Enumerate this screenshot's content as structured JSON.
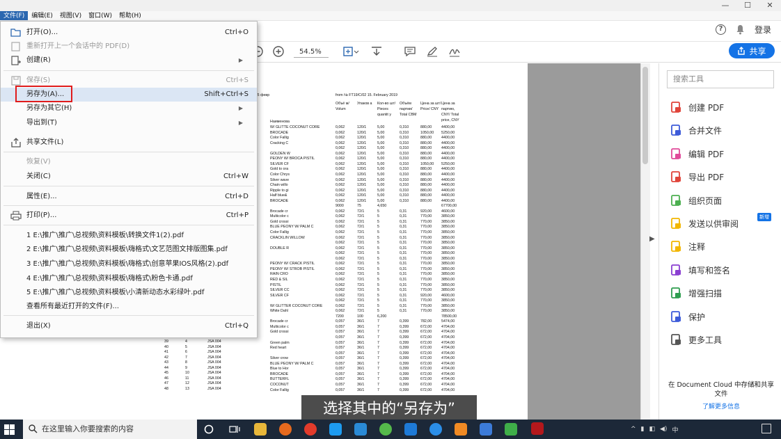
{
  "menubar": {
    "items": [
      "文件(F)",
      "编辑(E)",
      "视图(V)",
      "窗口(W)",
      "帮助(H)"
    ]
  },
  "header": {
    "login": "登录"
  },
  "toolbar": {
    "zoom": "54.5%",
    "share_label": "共享"
  },
  "file_menu": {
    "items": [
      {
        "label": "打开(O)...",
        "shortcut": "Ctrl+O",
        "icon": "folder-open-icon"
      },
      {
        "label": "重新打开上一个会话中的 PDF(D)",
        "shortcut": "",
        "disabled": true,
        "icon": "reopen-icon"
      },
      {
        "label": "创建(R)",
        "shortcut": "",
        "arrow": true,
        "icon": "create-pdf-icon"
      },
      {
        "label": "保存(S)",
        "shortcut": "Ctrl+S",
        "disabled": true,
        "icon": "save-icon"
      },
      {
        "label": "另存为(A)...",
        "shortcut": "Shift+Ctrl+S",
        "highlight": true
      },
      {
        "label": "另存为其它(H)",
        "shortcut": "",
        "arrow": true
      },
      {
        "label": "导出到(T)",
        "shortcut": "",
        "arrow": true
      },
      {
        "label": "共享文件(L)",
        "shortcut": "",
        "icon": "share-file-icon"
      },
      {
        "label": "恢复(V)",
        "shortcut": "",
        "disabled": true
      },
      {
        "label": "关闭(C)",
        "shortcut": "Ctrl+W"
      },
      {
        "label": "属性(E)...",
        "shortcut": "Ctrl+D"
      },
      {
        "label": "打印(P)...",
        "shortcut": "Ctrl+P",
        "icon": "printer-icon"
      },
      {
        "label": "1 E:\\推广\\推广\\总视频\\资料模板\\转换文件1(2).pdf",
        "shortcut": ""
      },
      {
        "label": "2 E:\\推广\\推广\\总视频\\资料模板\\嗨格式\\文艺范图文排版图集.pdf",
        "shortcut": ""
      },
      {
        "label": "3 E:\\推广\\推广\\总视频\\资料模板\\嗨格式\\创意苹果IOS风格(2).pdf",
        "shortcut": ""
      },
      {
        "label": "4 E:\\推广\\推广\\总视频\\资料模板\\嗨格式\\粉色卡通.pdf",
        "shortcut": ""
      },
      {
        "label": "5 E:\\推广\\推广\\总视频\\资料模板\\小清新动态水彩绿叶.pdf",
        "shortcut": ""
      },
      {
        "label": "查看所有最近打开的文件(F)...",
        "shortcut": ""
      },
      {
        "label": "退出(X)",
        "shortcut": "Ctrl+Q"
      }
    ]
  },
  "right_panel": {
    "search_placeholder": "搜索工具",
    "tools": [
      {
        "label": "创建 PDF",
        "icon": "create-pdf-tool-icon",
        "color": "#e0443a"
      },
      {
        "label": "合并文件",
        "icon": "combine-files-icon",
        "color": "#3d5bd9"
      },
      {
        "label": "编辑 PDF",
        "icon": "edit-pdf-icon",
        "color": "#e04a9a"
      },
      {
        "label": "导出 PDF",
        "icon": "export-pdf-icon",
        "color": "#e0443a"
      },
      {
        "label": "组织页面",
        "icon": "organize-pages-icon",
        "color": "#4caf50"
      },
      {
        "label": "发送以供审阅",
        "icon": "send-review-icon",
        "color": "#f2b600"
      },
      {
        "label": "注释",
        "icon": "comment-icon",
        "color": "#f2b600"
      },
      {
        "label": "填写和签名",
        "icon": "fill-sign-icon",
        "color": "#8a3fd1"
      },
      {
        "label": "增强扫描",
        "icon": "enhance-scan-icon",
        "color": "#2e9d4f"
      },
      {
        "label": "保护",
        "icon": "protect-icon",
        "color": "#3d5bd9"
      },
      {
        "label": "更多工具",
        "icon": "more-tools-icon",
        "color": "#555555"
      }
    ],
    "new_badge": "新增",
    "cloud_text": "在 Document Cloud 中存储和共享文件",
    "cloud_link": "了解更多信息"
  },
  "document": {
    "header_left": "от 15 февр",
    "header_mid": "from № FT19/C/02 15. February 2019",
    "col_headers": [
      "Объё м/ Volum",
      "Упаков а",
      "Кол-во шт/ Pieces quantit y",
      "Объём партии/ Total CBM",
      "Цена за шт/ Price/ CNY",
      "Цена за партию, CNY/ Total price, CNY"
    ],
    "col_name": "Наименова",
    "rows": [
      {
        "name": "W/ GLITTE COCONUT CORE",
        "v": "0,062",
        "p": "120/1",
        "q": "5,00",
        "c": "0,310",
        "pr": "880,00",
        "t": "4400,00"
      },
      {
        "name": "BROCADE",
        "v": "0,062",
        "p": "120/1",
        "q": "5,00",
        "c": "0,310",
        "pr": "1050,00",
        "t": "5250,00"
      },
      {
        "name": "Color Fallig",
        "v": "0,062",
        "p": "120/1",
        "q": "5,00",
        "c": "0,310",
        "pr": "880,00",
        "t": "4400,00"
      },
      {
        "name": "Cracking C",
        "v": "0,062",
        "p": "120/1",
        "q": "5,00",
        "c": "0,310",
        "pr": "880,00",
        "t": "4400,00"
      },
      {
        "name": "",
        "v": "0,062",
        "p": "120/1",
        "q": "5,00",
        "c": "0,310",
        "pr": "880,00",
        "t": "4400,00"
      },
      {
        "name": "GOLDEN W",
        "v": "0,062",
        "p": "120/1",
        "q": "5,00",
        "c": "0,310",
        "pr": "880,00",
        "t": "4400,00"
      },
      {
        "name": "PEONY   W/ BROCA PISTIL",
        "v": "0,062",
        "p": "120/1",
        "q": "5,00",
        "c": "0,310",
        "pr": "880,00",
        "t": "4400,00"
      },
      {
        "name": "SILVER CF",
        "v": "0,062",
        "p": "120/1",
        "q": "5,00",
        "c": "0,310",
        "pr": "1050,00",
        "t": "5250,00"
      },
      {
        "name": "Gold to ora",
        "v": "0,062",
        "p": "120/1",
        "q": "5,00",
        "c": "0,310",
        "pr": "880,00",
        "t": "4400,00"
      },
      {
        "name": "Color Chrys",
        "v": "0,062",
        "p": "120/1",
        "q": "5,00",
        "c": "0,310",
        "pr": "880,00",
        "t": "4400,00"
      },
      {
        "name": "Silver wave",
        "v": "0,062",
        "p": "120/1",
        "q": "5,00",
        "c": "0,310",
        "pr": "880,00",
        "t": "4400,00"
      },
      {
        "name": "Chain willo",
        "v": "0,062",
        "p": "120/1",
        "q": "5,00",
        "c": "0,310",
        "pr": "880,00",
        "t": "4400,00"
      },
      {
        "name": "Ripple to gi",
        "v": "0,062",
        "p": "120/1",
        "q": "5,00",
        "c": "0,310",
        "pr": "880,00",
        "t": "4400,00"
      },
      {
        "name": "Half blue&",
        "v": "0,062",
        "p": "120/1",
        "q": "5,00",
        "c": "0,310",
        "pr": "880,00",
        "t": "4400,00"
      },
      {
        "name": "BROCADE",
        "v": "0,062",
        "p": "120/1",
        "q": "5,00",
        "c": "0,310",
        "pr": "880,00",
        "t": "4400,00"
      },
      {
        "name": "",
        "v": "9000",
        "p": "75",
        "q": "4,650",
        "c": "",
        "pr": "",
        "t": "67700,00"
      },
      {
        "name": "Brocade cr",
        "v": "0,062",
        "p": "72/1",
        "q": "5",
        "c": "0,31",
        "pr": "920,00",
        "t": "4600,00"
      },
      {
        "name": "Multicolor c",
        "v": "0,062",
        "p": "72/1",
        "q": "5",
        "c": "0,31",
        "pr": "770,00",
        "t": "3850,00"
      },
      {
        "name": "Gold crossi",
        "v": "0,062",
        "p": "72/1",
        "q": "5",
        "c": "0,31",
        "pr": "770,00",
        "t": "3850,00"
      },
      {
        "name": "BLUE   PEONY   W/ PALM C",
        "v": "0,062",
        "p": "72/1",
        "q": "5",
        "c": "0,31",
        "pr": "770,00",
        "t": "3850,00"
      },
      {
        "name": "Color Fallig",
        "v": "0,062",
        "p": "72/1",
        "q": "5",
        "c": "0,31",
        "pr": "770,00",
        "t": "3850,00"
      },
      {
        "name": "CRACKLIN WILLOW",
        "v": "0,062",
        "p": "72/1",
        "q": "5",
        "c": "0,31",
        "pr": "770,00",
        "t": "3850,00"
      },
      {
        "name": "",
        "v": "0,062",
        "p": "72/1",
        "q": "5",
        "c": "0,31",
        "pr": "770,00",
        "t": "3850,00"
      },
      {
        "name": "DOUBLE R",
        "v": "0,062",
        "p": "72/1",
        "q": "5",
        "c": "0,31",
        "pr": "770,00",
        "t": "3850,00"
      },
      {
        "name": "",
        "v": "0,062",
        "p": "72/1",
        "q": "5",
        "c": "0,31",
        "pr": "770,00",
        "t": "3850,00"
      },
      {
        "name": "",
        "v": "0,062",
        "p": "72/1",
        "q": "5",
        "c": "0,31",
        "pr": "770,00",
        "t": "3850,00"
      },
      {
        "name": "PEONY   W/ CRACK PISTIL",
        "v": "0,062",
        "p": "72/1",
        "q": "5",
        "c": "0,31",
        "pr": "770,00",
        "t": "3850,00"
      },
      {
        "name": "PEONY   W/ STROB PISTIL",
        "v": "0,062",
        "p": "72/1",
        "q": "5",
        "c": "0,31",
        "pr": "770,00",
        "t": "3850,00"
      },
      {
        "name": "RAIN CRO",
        "v": "0,062",
        "p": "72/1",
        "q": "5",
        "c": "0,31",
        "pr": "770,00",
        "t": "3850,00"
      },
      {
        "name": "RED & SIL",
        "v": "0,062",
        "p": "72/1",
        "q": "5",
        "c": "0,31",
        "pr": "770,00",
        "t": "3850,00"
      },
      {
        "name": "PISTIL",
        "v": "0,062",
        "p": "72/1",
        "q": "5",
        "c": "0,31",
        "pr": "770,00",
        "t": "3850,00"
      },
      {
        "name": "SILVER CC",
        "v": "0,062",
        "p": "72/1",
        "q": "5",
        "c": "0,31",
        "pr": "770,00",
        "t": "3850,00"
      },
      {
        "name": "SILVER CF",
        "v": "0,062",
        "p": "72/1",
        "q": "5",
        "c": "0,31",
        "pr": "920,00",
        "t": "4600,00"
      },
      {
        "name": "",
        "v": "0,062",
        "p": "72/1",
        "q": "5",
        "c": "0,31",
        "pr": "770,00",
        "t": "3850,00"
      },
      {
        "name": "W/   GLITTER COCONUT CORE",
        "v": "0,062",
        "p": "72/1",
        "q": "5",
        "c": "0,31",
        "pr": "770,00",
        "t": "3850,00"
      },
      {
        "name": "White Dahl",
        "v": "0,062",
        "p": "72/1",
        "q": "5",
        "c": "0,31",
        "pr": "770,00",
        "t": "3850,00"
      },
      {
        "name": "",
        "v": "7200",
        "p": "100",
        "q": "6,200",
        "c": "",
        "pr": "",
        "t": "78500,00"
      },
      {
        "name": "Brocade cr",
        "v": "0,057",
        "p": "36/1",
        "q": "7",
        "c": "0,399",
        "pr": "782,00",
        "t": "5474,00"
      },
      {
        "name": "Multicolor c",
        "v": "0,057",
        "p": "36/1",
        "q": "7",
        "c": "0,399",
        "pr": "672,00",
        "t": "4704,00"
      },
      {
        "name": "Gold crossi",
        "v": "0,057",
        "p": "36/1",
        "q": "7",
        "c": "0,399",
        "pr": "672,00",
        "t": "4704,00"
      },
      {
        "name": "",
        "v": "0,057",
        "p": "36/1",
        "q": "7",
        "c": "0,399",
        "pr": "672,00",
        "t": "4704,00"
      },
      {
        "name": "Green palm",
        "v": "0,057",
        "p": "36/1",
        "q": "7",
        "c": "0,399",
        "pr": "672,00",
        "t": "4704,00"
      },
      {
        "name": "Red heart",
        "v": "0,057",
        "p": "36/1",
        "q": "7",
        "c": "0,399",
        "pr": "672,00",
        "t": "4704,00"
      },
      {
        "name": "",
        "v": "0,057",
        "p": "36/1",
        "q": "7",
        "c": "0,399",
        "pr": "672,00",
        "t": "4704,00"
      },
      {
        "name": "Silver crow",
        "v": "0,057",
        "p": "36/1",
        "q": "7",
        "c": "0,399",
        "pr": "672,00",
        "t": "4704,00"
      },
      {
        "name": "BLUE   PEONY   W/ PALM C",
        "v": "0,057",
        "p": "36/1",
        "q": "7",
        "c": "0,399",
        "pr": "672,00",
        "t": "4704,00"
      },
      {
        "name": "Blue to Hor",
        "v": "0,057",
        "p": "36/1",
        "q": "7",
        "c": "0,399",
        "pr": "672,00",
        "t": "4704,00"
      },
      {
        "name": "BROCADE",
        "v": "0,057",
        "p": "36/1",
        "q": "7",
        "c": "0,399",
        "pr": "672,00",
        "t": "4704,00"
      },
      {
        "name": "BUTTERFL",
        "v": "0,057",
        "p": "36/1",
        "q": "7",
        "c": "0,399",
        "pr": "672,00",
        "t": "4704,00"
      },
      {
        "name": "COCONUT",
        "v": "0,057",
        "p": "36/1",
        "q": "7",
        "c": "0,399",
        "pr": "672,00",
        "t": "4704,00"
      },
      {
        "name": "Color Fallig",
        "v": "0,057",
        "p": "36/1",
        "q": "7",
        "c": "0,399",
        "pr": "672,00",
        "t": "4704,00"
      }
    ],
    "left_rows": [
      {
        "no": "39",
        "n": "4",
        "code": "JSA 004"
      },
      {
        "no": "40",
        "n": "5",
        "code": "JSA 004"
      },
      {
        "no": "41",
        "n": "6",
        "code": "JSA 004"
      },
      {
        "no": "42",
        "n": "7",
        "code": "JSA 004"
      },
      {
        "no": "43",
        "n": "8",
        "code": "JSA 004"
      },
      {
        "no": "44",
        "n": "9",
        "code": "JSA 004"
      },
      {
        "no": "45",
        "n": "10",
        "code": "JSA 004"
      },
      {
        "no": "46",
        "n": "11",
        "code": "JSA 004"
      },
      {
        "no": "47",
        "n": "12",
        "code": "JSA 004"
      },
      {
        "no": "48",
        "n": "13",
        "code": "JSA 004"
      }
    ]
  },
  "subtitle": "选择其中的“另存为”",
  "taskbar": {
    "search_placeholder": "在这里输入你要搜索的内容"
  }
}
